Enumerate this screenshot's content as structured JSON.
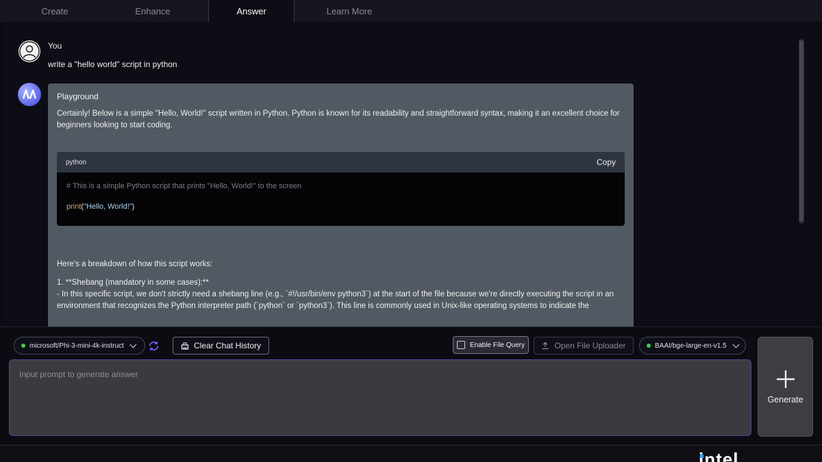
{
  "tabs": [
    {
      "label": "Create",
      "active": false
    },
    {
      "label": "Enhance",
      "active": false
    },
    {
      "label": "Answer",
      "active": true
    },
    {
      "label": "Learn More",
      "active": false
    }
  ],
  "chat": {
    "user": {
      "name": "You",
      "message": "write a \"hello world\" script in python"
    },
    "assistant": {
      "name": "Playground",
      "intro": "Certainly! Below is a simple \"Hello, World!\" script written in Python. Python is known for its readability and straightforward syntax, making it an excellent choice for beginners looking to start coding.",
      "code": {
        "language": "python",
        "copy_label": "Copy",
        "comment": "# This is a simple Python script that prints \"Hello, World!\" to the screen",
        "fn": "print",
        "open_paren": "(",
        "string": "\"Hello, World!\"",
        "close_paren": ")"
      },
      "breakdown_intro": "Here's a breakdown of how this script works:",
      "point1_title": "1. **Shebang (mandatory in some cases):**",
      "point1_body": "- In this specific script, we don't strictly need a shebang line (e.g., `#!/usr/bin/env python3`) at the start of the file because we're directly executing the script in an environment that recognizes the Python interpreter path (`python` or `python3`). This line is commonly used in Unix-like operating systems to indicate the"
    }
  },
  "controls": {
    "model_select": "microsoft/Phi-3-mini-4k-instruct",
    "clear_history": "Clear Chat History",
    "enable_file_query": "Enable File Query",
    "open_uploader": "Open File Uploader",
    "embedding_select": "BAAI/bge-large-en-v1.5",
    "status_color": "#3fcf4f"
  },
  "prompt": {
    "placeholder": "Input prompt to generate answer",
    "value": ""
  },
  "generate": {
    "label": "Generate"
  },
  "footer": {
    "logo": "intel"
  }
}
